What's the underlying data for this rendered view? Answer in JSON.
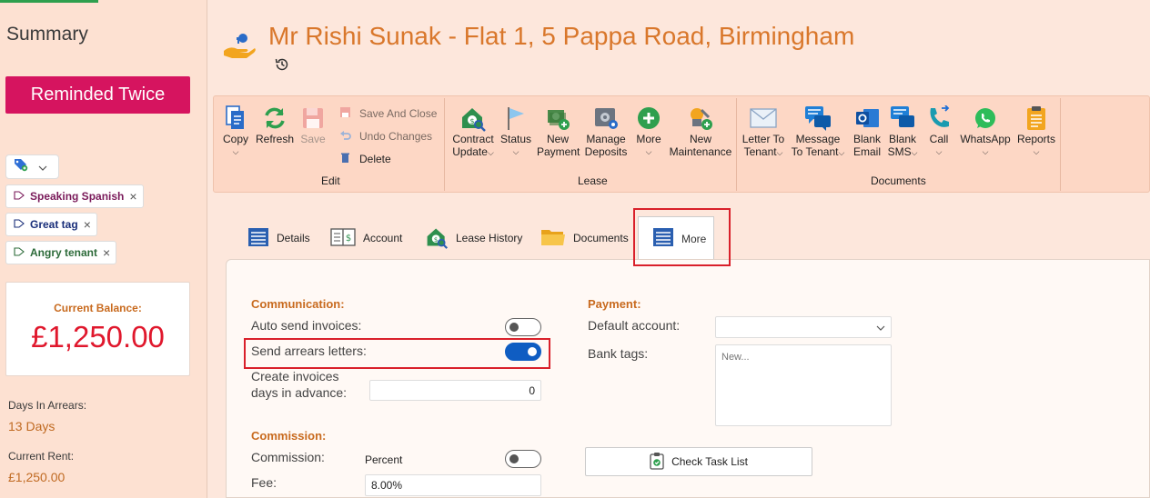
{
  "sidebar": {
    "summary_label": "Summary",
    "status_button": "Reminded Twice",
    "tags": [
      {
        "label": "Speaking Spanish",
        "color": "#7a1a5a"
      },
      {
        "label": "Great tag",
        "color": "#1a2f7a"
      },
      {
        "label": "Angry tenant",
        "color": "#2d6b3a"
      }
    ],
    "balance_label": "Current Balance:",
    "balance_value": "£1,250.00",
    "days_in_arrears_label": "Days In Arrears:",
    "days_in_arrears_value": "13 Days",
    "current_rent_label": "Current Rent:",
    "current_rent_value": "£1,250.00"
  },
  "header": {
    "title": "Mr Rishi Sunak - Flat 1, 5 Pappa Road, Birmingham"
  },
  "ribbon": {
    "edit": {
      "copy": "Copy",
      "refresh": "Refresh",
      "save": "Save",
      "save_and_close": "Save And Close",
      "undo_changes": "Undo Changes",
      "delete": "Delete",
      "group": "Edit"
    },
    "lease": {
      "contract_update_1": "Contract",
      "contract_update_2": "Update",
      "status": "Status",
      "new_payment_1": "New",
      "new_payment_2": "Payment",
      "manage_deposits_1": "Manage",
      "manage_deposits_2": "Deposits",
      "more": "More",
      "new_maintenance_1": "New",
      "new_maintenance_2": "Maintenance",
      "group": "Lease"
    },
    "documents": {
      "letter_1": "Letter To",
      "letter_2": "Tenant",
      "message_1": "Message",
      "message_2": "To Tenant",
      "blank_email_1": "Blank",
      "blank_email_2": "Email",
      "blank_sms_1": "Blank",
      "blank_sms_2": "SMS",
      "call": "Call",
      "whatsapp": "WhatsApp",
      "reports": "Reports",
      "group": "Documents"
    }
  },
  "tabs": {
    "details": "Details",
    "account": "Account",
    "lease_history": "Lease History",
    "documents": "Documents",
    "more": "More"
  },
  "more": {
    "communication": {
      "heading": "Communication:",
      "auto_send_invoices": "Auto send invoices:",
      "auto_send_invoices_on": false,
      "send_arrears_letters": "Send arrears letters:",
      "send_arrears_letters_on": true,
      "create_invoices_1": "Create invoices",
      "create_invoices_2": "days in advance:",
      "create_invoices_value": "0"
    },
    "commission": {
      "heading": "Commission:",
      "commission_label": "Commission:",
      "commission_type": "Percent",
      "commission_on": false,
      "fee_label": "Fee:",
      "fee_value": "8.00%"
    },
    "payment": {
      "heading": "Payment:",
      "default_account_label": "Default account:",
      "default_account_value": "",
      "bank_tags_label": "Bank tags:",
      "bank_tags_placeholder": "New..."
    },
    "check_task_list": "Check Task List"
  }
}
